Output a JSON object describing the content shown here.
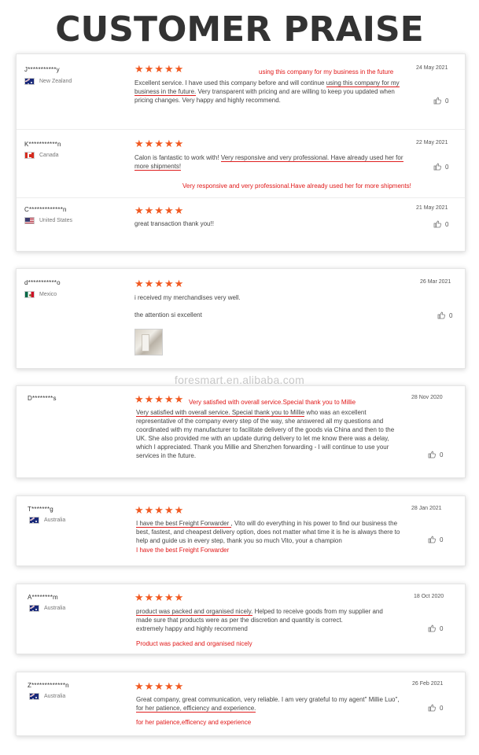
{
  "page": {
    "title": "CUSTOMER PRAISE",
    "watermark": "foresmart.en.alibaba.com",
    "accent_color": "#f15a22",
    "highlight_color": "#e01818"
  },
  "reviews": [
    {
      "user": "J***********y",
      "country": "New Zealand",
      "flag_icon": "flag-au-icon",
      "stars": "★★★★★",
      "date": "24 May 2021",
      "text_before": "Excellent service. I have used this company before and will continue ",
      "text_underlined": "using this company for my business in the future.",
      "text_after": " Very transparent with pricing and are willing to keep you updated when pricing changes. Very happy and highly recommend.",
      "highlight": "using this company for my business in the future",
      "likes": "0"
    },
    {
      "user": "K***********n",
      "country": "Canada",
      "flag_icon": "flag-ca-icon",
      "stars": "★★★★★",
      "date": "22 May 2021",
      "text_before": "Calon is fantastic to work with! ",
      "text_underlined": "Very responsive and very professional. Have already used her for more shipments!",
      "text_after": "",
      "highlight": "Very responsive and very professional.Have already used her for more shipments!",
      "likes": "0"
    },
    {
      "user": "C*************n",
      "country": "United States",
      "flag_icon": "flag-us-icon",
      "stars": "★★★★★",
      "date": "21 May 2021",
      "text_before": "great transaction thank you!!",
      "likes": "0"
    },
    {
      "user": "d***********o",
      "country": "Mexico",
      "flag_icon": "flag-mx-icon",
      "stars": "★★★★★",
      "date": "26 Mar 2021",
      "text_line1": "i received my merchandises very well.",
      "text_line2": "the attention si excellent",
      "likes": "0"
    },
    {
      "user": "D********s",
      "stars": "★★★★★",
      "date": "28 Nov 2020",
      "highlight": "Very satisfied with overall service.Special thank you to Millie",
      "text_underlined": "Very satisfied with overall service. Special thank you to Millie",
      "text_after": " who was an excellent representative of the company every step of the way, she answered all my questions and coordinated with my manufacturer to facilitate delivery of the goods via China and then to the UK. She also provided me with an update during delivery to let me know there was a delay, which I appreciated. Thank you Millie and Shenzhen forwarding - I will continue to use your services in the future.",
      "likes": "0"
    },
    {
      "user": "T*******g",
      "country": "Australia",
      "flag_icon": "flag-au-icon",
      "stars": "★★★★★",
      "date": "28 Jan 2021",
      "text_underlined": "I have the best Freight Forwarder ",
      "text_after": ", Vito will do everything in his power to find our business the best, fastest, and cheapest delivery option, does not matter what time it is he is always there to help and guide us in every step, thank you so much Vito, your a champion",
      "highlight": "I have the best Freight Forwarder",
      "likes": "0"
    },
    {
      "user": "A********m",
      "country": "Australia",
      "flag_icon": "flag-au-icon",
      "stars": "★★★★★",
      "date": "18 Oct 2020",
      "text_underlined": "product was packed and organised nicely.",
      "text_after": " Helped to receive goods from my supplier and made sure that products were as per the discretion and quantity is correct.",
      "text_line2": "extremely happy and highly recommend",
      "highlight": "Product was packed and organised nicely",
      "likes": "0"
    },
    {
      "user": "Z*************n",
      "country": "Australia",
      "flag_icon": "flag-au-icon",
      "stars": "★★★★★",
      "date": "26 Feb 2021",
      "text_before": "Great company, great communication, very reliable. I am very grateful to my agent\" Millie Luo\", ",
      "text_underlined": "for her patience, efficiency and experience.",
      "highlight": "for her patience,efficency and experience",
      "likes": "0"
    }
  ]
}
